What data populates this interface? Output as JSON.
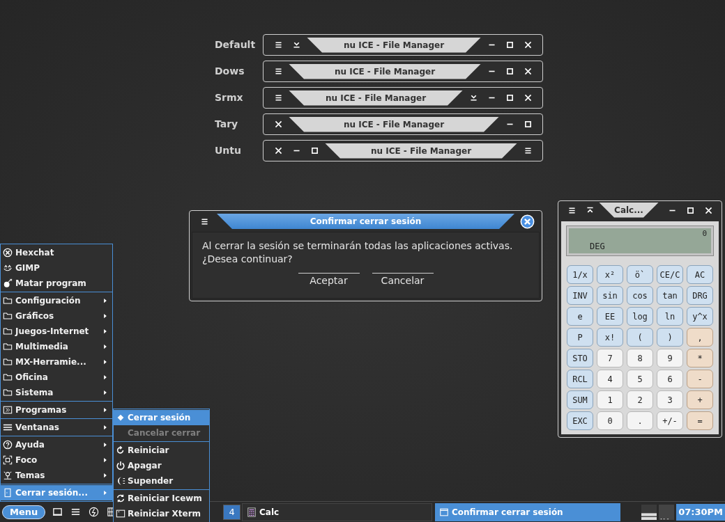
{
  "decor_styles": [
    {
      "label": "Default",
      "title": "nu ICE - File Manager",
      "left_buttons": [
        {
          "kind": "menu"
        },
        {
          "kind": "rolldown"
        }
      ],
      "right_buttons": [
        {
          "kind": "minimize"
        },
        {
          "kind": "maximize"
        },
        {
          "kind": "close"
        }
      ]
    },
    {
      "label": "Dows",
      "title": "nu ICE - File Manager",
      "left_buttons": [
        {
          "kind": "menu"
        }
      ],
      "right_buttons": [
        {
          "kind": "minimize"
        },
        {
          "kind": "maximize"
        },
        {
          "kind": "close"
        }
      ]
    },
    {
      "label": "Srmx",
      "title": "nu ICE - File Manager",
      "left_buttons": [
        {
          "kind": "menu"
        }
      ],
      "right_buttons": [
        {
          "kind": "rolldown"
        },
        {
          "kind": "minimize"
        },
        {
          "kind": "maximize"
        },
        {
          "kind": "close"
        }
      ]
    },
    {
      "label": "Tary",
      "title": "nu ICE - File Manager",
      "left_buttons": [
        {
          "kind": "close"
        }
      ],
      "right_buttons": [
        {
          "kind": "minimize"
        },
        {
          "kind": "maximize"
        }
      ]
    },
    {
      "label": "Untu",
      "title": "nu ICE - File Manager",
      "left_buttons": [
        {
          "kind": "close"
        },
        {
          "kind": "minimize"
        },
        {
          "kind": "maximize"
        }
      ],
      "right_buttons": [
        {
          "kind": "menu"
        }
      ]
    }
  ],
  "dialog": {
    "title": "Confirmar cerrar sesión",
    "message": "Al cerrar la sesión se terminarán todas las aplicaciones activas.\n¿Desea continuar?",
    "buttons": [
      "Aceptar",
      "Cancelar"
    ]
  },
  "calculator": {
    "title": "Calc...",
    "display_value": "0",
    "display_mode": "DEG",
    "keys": [
      {
        "label": "1/x",
        "kind": "fn"
      },
      {
        "label": "x²",
        "kind": "fn"
      },
      {
        "label": "ö`",
        "kind": "fn"
      },
      {
        "label": "CE/C",
        "kind": "fn"
      },
      {
        "label": "AC",
        "kind": "fn"
      },
      {
        "label": "INV",
        "kind": "fn"
      },
      {
        "label": "sin",
        "kind": "fn"
      },
      {
        "label": "cos",
        "kind": "fn"
      },
      {
        "label": "tan",
        "kind": "fn"
      },
      {
        "label": "DRG",
        "kind": "fn"
      },
      {
        "label": "e",
        "kind": "fn"
      },
      {
        "label": "EE",
        "kind": "fn"
      },
      {
        "label": "log",
        "kind": "fn"
      },
      {
        "label": "ln",
        "kind": "fn"
      },
      {
        "label": "y^x",
        "kind": "fn"
      },
      {
        "label": "P",
        "kind": "fn"
      },
      {
        "label": "x!",
        "kind": "fn"
      },
      {
        "label": "(",
        "kind": "fn"
      },
      {
        "label": ")",
        "kind": "fn"
      },
      {
        "label": ",",
        "kind": "op"
      },
      {
        "label": "STO",
        "kind": "fn"
      },
      {
        "label": "7",
        "kind": "num"
      },
      {
        "label": "8",
        "kind": "num"
      },
      {
        "label": "9",
        "kind": "num"
      },
      {
        "label": "*",
        "kind": "op"
      },
      {
        "label": "RCL",
        "kind": "fn"
      },
      {
        "label": "4",
        "kind": "num"
      },
      {
        "label": "5",
        "kind": "num"
      },
      {
        "label": "6",
        "kind": "num"
      },
      {
        "label": "-",
        "kind": "op"
      },
      {
        "label": "SUM",
        "kind": "fn"
      },
      {
        "label": "1",
        "kind": "num"
      },
      {
        "label": "2",
        "kind": "num"
      },
      {
        "label": "3",
        "kind": "num"
      },
      {
        "label": "+",
        "kind": "op"
      },
      {
        "label": "EXC",
        "kind": "fn"
      },
      {
        "label": "0",
        "kind": "num"
      },
      {
        "label": ".",
        "kind": "num"
      },
      {
        "label": "+/-",
        "kind": "num"
      },
      {
        "label": "=",
        "kind": "op"
      }
    ]
  },
  "start_menu": {
    "groups": [
      [
        {
          "label": "Hexchat",
          "kind": "chat",
          "submenu": false,
          "selected": false
        },
        {
          "label": "GIMP",
          "kind": "gimp",
          "submenu": false,
          "selected": false
        },
        {
          "label": "Matar program",
          "kind": "bomb",
          "submenu": false,
          "selected": false
        }
      ],
      [
        {
          "label": "Configuración",
          "kind": "folder",
          "submenu": true,
          "selected": false
        },
        {
          "label": "Gráficos",
          "kind": "folder",
          "submenu": true,
          "selected": false
        },
        {
          "label": "Juegos-Internet",
          "kind": "folder",
          "submenu": true,
          "selected": false
        },
        {
          "label": "Multimedia",
          "kind": "folder",
          "submenu": true,
          "selected": false
        },
        {
          "label": "MX-Herramie...",
          "kind": "folder",
          "submenu": true,
          "selected": false
        },
        {
          "label": "Oficina",
          "kind": "folder",
          "submenu": true,
          "selected": false
        },
        {
          "label": "Sistema",
          "kind": "folder",
          "submenu": true,
          "selected": false
        }
      ],
      [
        {
          "label": "Programas",
          "kind": "programs",
          "submenu": true,
          "selected": false
        }
      ],
      [
        {
          "label": "Ventanas",
          "kind": "windows",
          "submenu": true,
          "selected": false
        }
      ],
      [
        {
          "label": "Ayuda",
          "kind": "help",
          "submenu": true,
          "selected": false
        },
        {
          "label": "Foco",
          "kind": "focus",
          "submenu": true,
          "selected": false
        },
        {
          "label": "Temas",
          "kind": "themes",
          "submenu": true,
          "selected": false
        }
      ],
      [
        {
          "label": "Cerrar sesión...",
          "kind": "door",
          "submenu": true,
          "selected": true
        }
      ]
    ]
  },
  "logout_submenu": {
    "groups": [
      [
        {
          "label": "Cerrar sesión",
          "kind": "diamond",
          "selected": true,
          "disabled": false
        },
        {
          "label": "Cancelar cerrar",
          "kind": "plain",
          "selected": false,
          "disabled": true
        }
      ],
      [
        {
          "label": "Reiniciar",
          "kind": "restart",
          "selected": false,
          "disabled": false
        },
        {
          "label": "Apagar",
          "kind": "power",
          "selected": false,
          "disabled": false
        },
        {
          "label": "Supender",
          "kind": "moon",
          "selected": false,
          "disabled": false
        }
      ],
      [
        {
          "label": "Reiniciar Icewm",
          "kind": "reload",
          "selected": false,
          "disabled": false
        },
        {
          "label": "Reiniciar Xterm",
          "kind": "terminal",
          "selected": false,
          "disabled": false
        }
      ]
    ]
  },
  "taskbar": {
    "menu_button": "Menu",
    "workspace": "4",
    "tasks": [
      {
        "label": "Calc",
        "kind": "calc",
        "selected": false
      },
      {
        "label": "Confirmar cerrar sesión",
        "kind": "window",
        "selected": true
      }
    ],
    "clock": "07:30PM"
  }
}
